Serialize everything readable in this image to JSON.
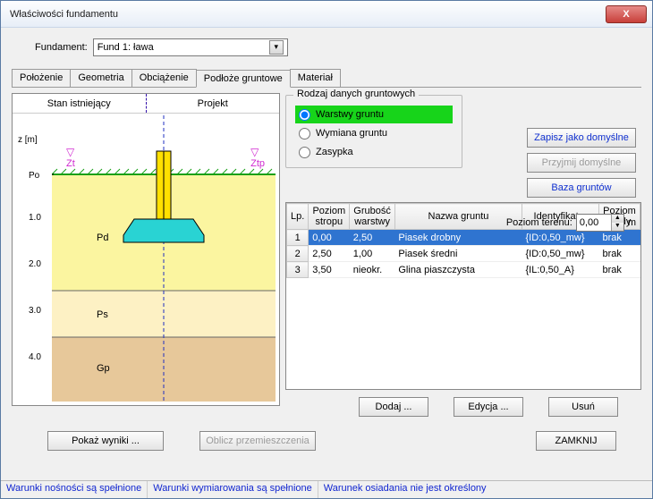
{
  "title": "Właściwości fundamentu",
  "fund_label": "Fundament:",
  "fund_value": "Fund 1: ława",
  "tabs": [
    "Położenie",
    "Geometria",
    "Obciążenie",
    "Podłoże gruntowe",
    "Materiał"
  ],
  "active_tab": 3,
  "cross": {
    "col1": "Stan istniejący",
    "col2": "Projekt",
    "z_label": "z [m]",
    "po_label": "Po",
    "zt_label": "Zt",
    "ztp_label": "Ztp",
    "ticks": [
      "1.0",
      "2.0",
      "3.0",
      "4.0"
    ],
    "layers": [
      "Pd",
      "Ps",
      "Gp"
    ]
  },
  "group": {
    "legend": "Rodzaj danych gruntowych",
    "r1": "Warstwy gruntu",
    "r2": "Wymiana gruntu",
    "r3": "Zasypka"
  },
  "rbtns": {
    "b1": "Zapisz jako domyślne",
    "b2": "Przyjmij domyślne",
    "b3": "Baza gruntów"
  },
  "poziom_lbl": "Poziom terenu:",
  "poziom_val": "0,00",
  "poziom_unit": "m",
  "grid": {
    "headers": [
      "Lp.",
      "Poziom stropu",
      "Grubość warstwy",
      "Nazwa gruntu",
      "Identyfikator",
      "Poziom wody"
    ],
    "rows": [
      {
        "lp": "1",
        "ps": "0,00",
        "gw": "2,50",
        "ng": "Piasek drobny",
        "id": "{ID:0,50_mw}",
        "pw": "brak"
      },
      {
        "lp": "2",
        "ps": "2,50",
        "gw": "1,00",
        "ng": "Piasek średni",
        "id": "{ID:0,50_mw}",
        "pw": "brak"
      },
      {
        "lp": "3",
        "ps": "3,50",
        "gw": "nieokr.",
        "ng": "Glina piaszczysta",
        "id": "{IL:0,50_A}",
        "pw": "brak"
      }
    ]
  },
  "bottom": {
    "dodaj": "Dodaj ...",
    "edycja": "Edycja ...",
    "usun": "Usuń"
  },
  "footer": {
    "pokaz": "Pokaż wyniki ...",
    "oblicz": "Oblicz przemieszczenia",
    "zamknij": "ZAMKNIJ"
  },
  "status": {
    "s1": "Warunki nośności są spełnione",
    "s2": "Warunki wymiarowania są spełnione",
    "s3": "Warunek osiadania nie jest określony"
  }
}
